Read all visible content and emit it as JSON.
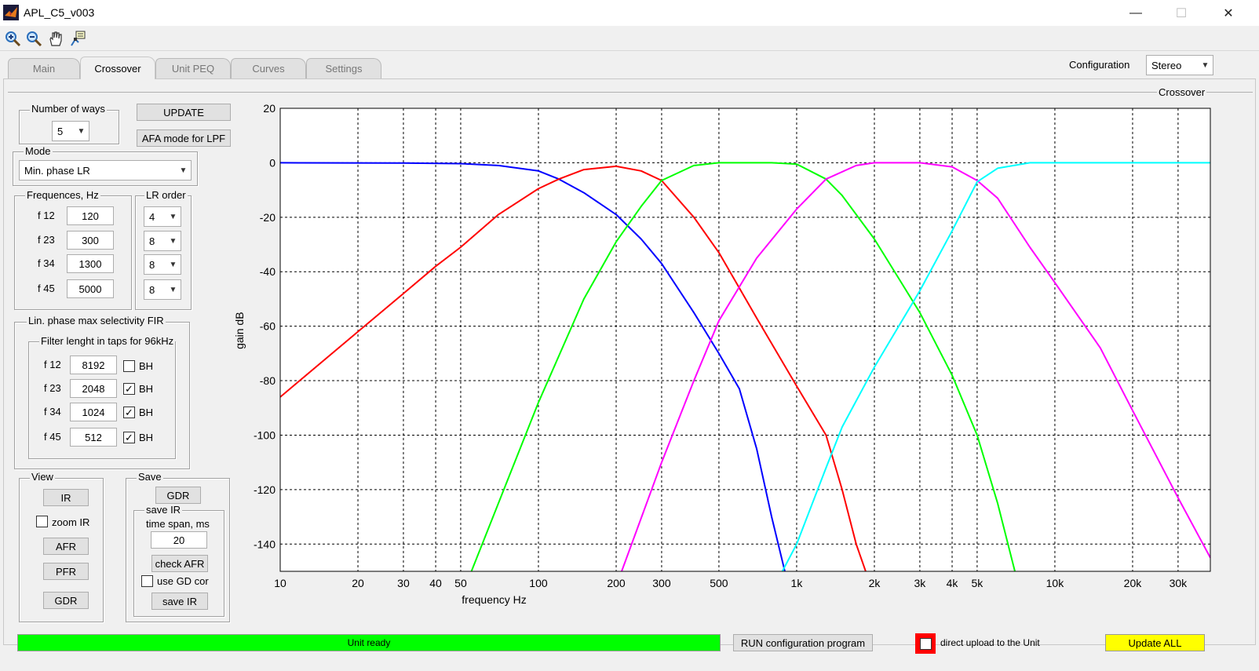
{
  "window": {
    "title": "APL_C5_v003",
    "minimize": "—",
    "maximize": "☐",
    "close": "✕"
  },
  "toolbar": {
    "zoom_in_icon": "zoom-in-icon",
    "zoom_out_icon": "zoom-out-icon",
    "pan_icon": "pan-hand-icon",
    "datatip_icon": "data-cursor-icon"
  },
  "tabs": [
    {
      "label": "Main",
      "active": false
    },
    {
      "label": "Crossover",
      "active": true
    },
    {
      "label": "Unit PEQ",
      "active": false
    },
    {
      "label": "Curves",
      "active": false
    },
    {
      "label": "Settings",
      "active": false
    }
  ],
  "configuration": {
    "label": "Configuration",
    "value": "Stereo"
  },
  "panel_title": "Crossover",
  "ways": {
    "title": "Number of ways",
    "value": "5"
  },
  "buttons": {
    "update": "UPDATE",
    "afa": "AFA mode for LPF"
  },
  "mode": {
    "title": "Mode",
    "value": "Min. phase LR"
  },
  "frequencies": {
    "title": "Frequences, Hz",
    "rows": [
      {
        "label": "f 12",
        "value": "120"
      },
      {
        "label": "f 23",
        "value": "300"
      },
      {
        "label": "f 34",
        "value": "1300"
      },
      {
        "label": "f 45",
        "value": "5000"
      }
    ]
  },
  "lr_order": {
    "title": "LR order",
    "values": [
      "4",
      "8",
      "8",
      "8"
    ]
  },
  "fir": {
    "title": "Lin. phase max selectivity FIR",
    "sub_title": "Filter lenght in taps for 96kHz",
    "rows": [
      {
        "label": "f 12",
        "value": "8192",
        "bh_checked": false,
        "bh_label": "BH"
      },
      {
        "label": "f 23",
        "value": "2048",
        "bh_checked": true,
        "bh_label": "BH"
      },
      {
        "label": "f 34",
        "value": "1024",
        "bh_checked": true,
        "bh_label": "BH"
      },
      {
        "label": "f 45",
        "value": "512",
        "bh_checked": true,
        "bh_label": "BH"
      }
    ]
  },
  "view": {
    "title": "View",
    "ir": "IR",
    "zoom_ir": "zoom IR",
    "zoom_ir_checked": false,
    "afr": "AFR",
    "pfr": "PFR",
    "gdr": "GDR"
  },
  "save": {
    "title": "Save",
    "gdr": "GDR",
    "save_ir_title": "save IR",
    "time_span_label": "time span, ms",
    "time_span_value": "20",
    "check_afr": "check AFR",
    "use_gd_cor": "use GD cor",
    "use_gd_cor_checked": false,
    "save_ir": "save IR"
  },
  "status": {
    "text": "Unit ready",
    "run_config": "RUN configuration program",
    "direct_upload": "direct upload to the Unit",
    "direct_upload_checked": false,
    "update_all": "Update ALL"
  },
  "colors": {
    "status_green": "#00ff00",
    "update_yellow": "#ffff00",
    "upload_box": "#ff0000"
  },
  "chart_data": {
    "type": "line",
    "xlabel": "frequency   Hz",
    "ylabel": "gain dB",
    "xscale": "log",
    "xlim": [
      10,
      40000
    ],
    "ylim": [
      -150,
      20
    ],
    "grid": true,
    "x_ticks": [
      10,
      20,
      30,
      40,
      50,
      100,
      200,
      300,
      500,
      1000,
      2000,
      3000,
      4000,
      5000,
      10000,
      20000,
      30000
    ],
    "x_tick_labels": [
      "10",
      "20",
      "30",
      "40",
      "50",
      "100",
      "200",
      "300",
      "500",
      "1k",
      "2k",
      "3k",
      "4k",
      "5k",
      "10k",
      "20k",
      "30k"
    ],
    "y_ticks": [
      20,
      0,
      -20,
      -40,
      -60,
      -80,
      -100,
      -120,
      -140
    ],
    "y_tick_labels": [
      "20",
      "0",
      "-20",
      "-40",
      "-60",
      "-80",
      "-100",
      "-120",
      "-140"
    ],
    "series": [
      {
        "color": "#0000ff",
        "points": [
          [
            10,
            0
          ],
          [
            30,
            -0.1
          ],
          [
            50,
            -0.3
          ],
          [
            70,
            -1
          ],
          [
            100,
            -3
          ],
          [
            120,
            -6
          ],
          [
            150,
            -11
          ],
          [
            200,
            -19
          ],
          [
            250,
            -28
          ],
          [
            300,
            -37
          ],
          [
            400,
            -55
          ],
          [
            500,
            -70
          ],
          [
            600,
            -83
          ],
          [
            700,
            -105
          ],
          [
            800,
            -130
          ],
          [
            900,
            -150
          ]
        ]
      },
      {
        "color": "#ff0000",
        "points": [
          [
            10,
            -86
          ],
          [
            20,
            -62
          ],
          [
            30,
            -48
          ],
          [
            40,
            -38
          ],
          [
            50,
            -31
          ],
          [
            70,
            -19
          ],
          [
            100,
            -9.5
          ],
          [
            120,
            -6
          ],
          [
            150,
            -2.5
          ],
          [
            200,
            -1.3
          ],
          [
            250,
            -3
          ],
          [
            300,
            -6.5
          ],
          [
            400,
            -20
          ],
          [
            500,
            -33
          ],
          [
            700,
            -57
          ],
          [
            1000,
            -82
          ],
          [
            1300,
            -100
          ],
          [
            1500,
            -120
          ],
          [
            1700,
            -140
          ],
          [
            1850,
            -150
          ]
        ]
      },
      {
        "color": "#00ff00",
        "points": [
          [
            55,
            -150
          ],
          [
            70,
            -125
          ],
          [
            100,
            -88
          ],
          [
            150,
            -50
          ],
          [
            200,
            -29
          ],
          [
            250,
            -16
          ],
          [
            300,
            -6.5
          ],
          [
            400,
            -1
          ],
          [
            500,
            0
          ],
          [
            800,
            0
          ],
          [
            1000,
            -0.5
          ],
          [
            1300,
            -6
          ],
          [
            1500,
            -12
          ],
          [
            2000,
            -28
          ],
          [
            3000,
            -55
          ],
          [
            4000,
            -78
          ],
          [
            5000,
            -100
          ],
          [
            6000,
            -125
          ],
          [
            7000,
            -150
          ]
        ]
      },
      {
        "color": "#ff00ff",
        "points": [
          [
            210,
            -150
          ],
          [
            300,
            -110
          ],
          [
            400,
            -80
          ],
          [
            500,
            -58
          ],
          [
            700,
            -35
          ],
          [
            1000,
            -17
          ],
          [
            1300,
            -6
          ],
          [
            1700,
            -1
          ],
          [
            2000,
            0
          ],
          [
            3000,
            0
          ],
          [
            4000,
            -1.5
          ],
          [
            5000,
            -6.5
          ],
          [
            6000,
            -13
          ],
          [
            8000,
            -31
          ],
          [
            10000,
            -44
          ],
          [
            15000,
            -68
          ],
          [
            20000,
            -91
          ],
          [
            30000,
            -123
          ],
          [
            40000,
            -145
          ]
        ]
      },
      {
        "color": "#00ffff",
        "points": [
          [
            880,
            -150
          ],
          [
            1000,
            -140
          ],
          [
            1300,
            -112
          ],
          [
            1500,
            -97
          ],
          [
            2000,
            -75
          ],
          [
            3000,
            -47
          ],
          [
            4000,
            -25
          ],
          [
            5000,
            -7
          ],
          [
            6000,
            -2
          ],
          [
            8000,
            0
          ],
          [
            10000,
            0
          ],
          [
            40000,
            0
          ]
        ]
      }
    ]
  }
}
